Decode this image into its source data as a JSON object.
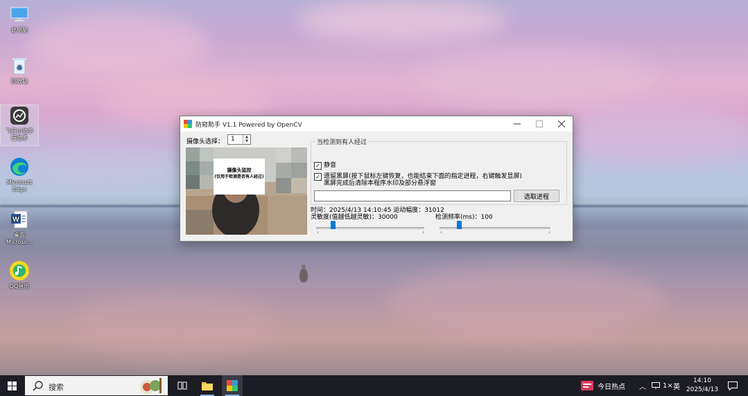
{
  "desktop": {
    "icons": [
      {
        "label": "此电脑"
      },
      {
        "label": "回收站"
      },
      {
        "label": "飞行小助手\n行助手"
      },
      {
        "label": "Microsoft\nEdge"
      },
      {
        "label": "桌面\nMicroso..."
      },
      {
        "label": "QQ音乐"
      }
    ]
  },
  "window": {
    "title": "防窥助手 V1.1 Powered by OpenCV",
    "camera_label": "摄像头选择：",
    "camera_value": "1",
    "preview": {
      "sign_line1": "摄像头监控",
      "sign_line2": "(仅用于检测是否有人经过)"
    },
    "group_title": "当检测到有人经过",
    "options": [
      {
        "label": "静音",
        "checked": true
      },
      {
        "label": "遗留黑屏(按下鼠标左键恢复，也能结束下面的指定进程，右键触发显屏)\n黑屏完成后清除本程序水印及部分悬浮窗",
        "checked": true
      }
    ],
    "path_value": "",
    "select_process_label": "选取进程",
    "status": "时间：2025/4/13 14:10:45 运动幅度：31012",
    "sensitivity_label": "灵敏度(值越低越灵敏)：30000",
    "frequency_label": "检测频率(ms)：100",
    "sensitivity_value": 30000,
    "frequency_value": 100
  },
  "taskbar": {
    "search_placeholder": "搜索",
    "news_label": "今日热点",
    "tray_lang": "英",
    "tray_extra": "1×",
    "time": "14:10",
    "date": "2025/4/13"
  }
}
